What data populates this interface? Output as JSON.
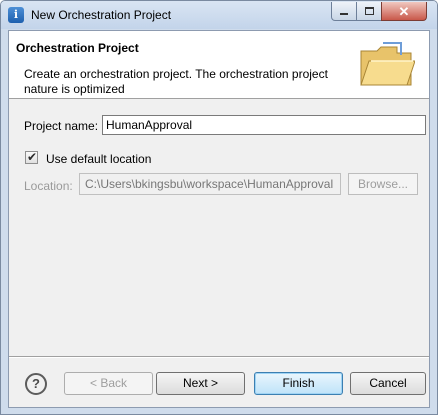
{
  "window": {
    "title": "New Orchestration Project",
    "app_icon": "info-icon",
    "controls": [
      "minimize",
      "maximize",
      "close"
    ]
  },
  "banner": {
    "title": "Orchestration Project",
    "description": "Create an orchestration project.  The orchestration project nature is optimized",
    "icon": "folder-icon"
  },
  "form": {
    "project_name_label": "Project name:",
    "project_name_value": "HumanApproval",
    "use_default_label": "Use default location",
    "use_default_checked": true,
    "location_label": "Location:",
    "location_value": "C:\\Users\\bkingsbu\\workspace\\HumanApproval",
    "browse_label": "Browse..."
  },
  "buttons": {
    "help": "?",
    "back": "< Back",
    "next": "Next >",
    "finish": "Finish",
    "cancel": "Cancel"
  },
  "colors": {
    "title_bar": "#c3d4ea",
    "default_button": "#3c7fb1",
    "disabled_text": "#9e9e9e"
  }
}
